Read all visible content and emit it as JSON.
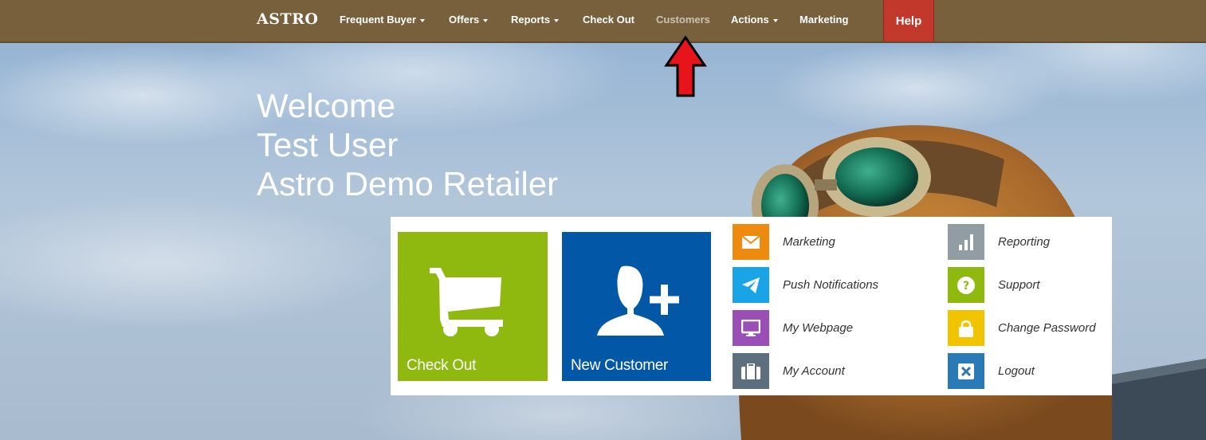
{
  "brand": {
    "name": "ASTRO"
  },
  "nav": {
    "items": [
      {
        "label": "Frequent Buyer",
        "dropdown": true
      },
      {
        "label": "Offers",
        "dropdown": true
      },
      {
        "label": "Reports",
        "dropdown": true
      },
      {
        "label": "Check Out",
        "dropdown": false
      },
      {
        "label": "Customers",
        "dropdown": false,
        "active": true
      },
      {
        "label": "Actions",
        "dropdown": true
      },
      {
        "label": "Marketing",
        "dropdown": false
      }
    ],
    "help_label": "Help"
  },
  "welcome": {
    "line1": "Welcome",
    "line2": "Test User",
    "line3": "Astro Demo Retailer"
  },
  "tiles": {
    "checkout": {
      "label": "Check Out",
      "icon": "shopping-cart-icon",
      "color": "#8fb90f"
    },
    "new_customer": {
      "label": "New Customer",
      "icon": "add-user-icon",
      "color": "#0258a7"
    }
  },
  "quick_links": {
    "left": [
      {
        "label": "Marketing",
        "icon": "envelope-icon",
        "color": "#ee8b0e"
      },
      {
        "label": "Push Notifications",
        "icon": "paper-plane-icon",
        "color": "#1aa4e8"
      },
      {
        "label": "My Webpage",
        "icon": "monitor-icon",
        "color": "#9a4fb6"
      },
      {
        "label": "My Account",
        "icon": "briefcase-icon",
        "color": "#5d6e7e"
      }
    ],
    "right": [
      {
        "label": "Reporting",
        "icon": "bar-chart-icon",
        "color": "#919da3"
      },
      {
        "label": "Support",
        "icon": "question-icon",
        "color": "#8fb90f"
      },
      {
        "label": "Change Password",
        "icon": "lock-icon",
        "color": "#f2c400"
      },
      {
        "label": "Logout",
        "icon": "close-box-icon",
        "color": "#2a7ab7"
      }
    ]
  },
  "colors": {
    "navbar": "#79603c",
    "help": "#c2392b",
    "annotation_arrow": "#e8141b"
  }
}
